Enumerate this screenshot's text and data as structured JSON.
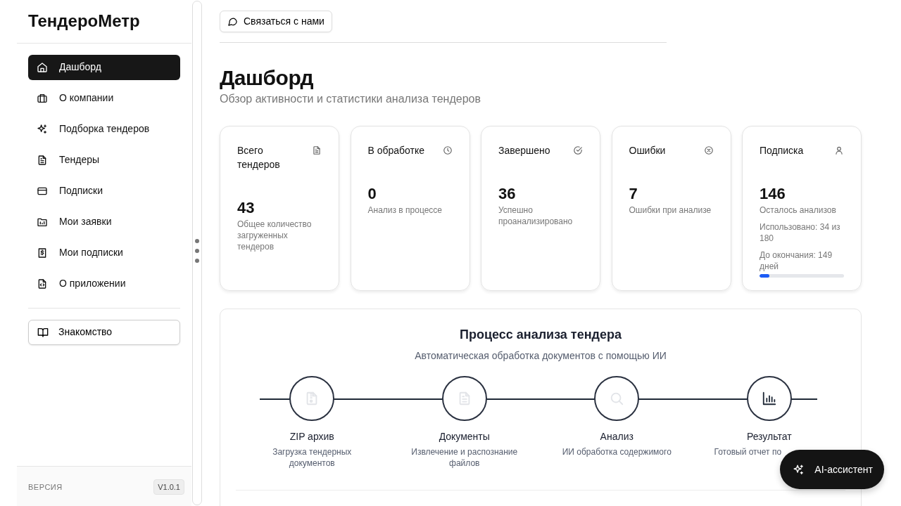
{
  "sidebar": {
    "logo": "ТендероМетр",
    "items": [
      {
        "label": "Дашборд",
        "selected": true
      },
      {
        "label": "О компании",
        "selected": false
      },
      {
        "label": "Подборка тендеров",
        "selected": false
      },
      {
        "label": "Тендеры",
        "selected": false
      },
      {
        "label": "Подписки",
        "selected": false
      },
      {
        "label": "Мои заявки",
        "selected": false
      },
      {
        "label": "Мои подписки",
        "selected": false
      },
      {
        "label": "О приложении",
        "selected": false
      }
    ],
    "tour_button": "Знакомство",
    "version_label": "ВЕРСИЯ",
    "version": "V1.0.1"
  },
  "contact_button": "Связаться с нами",
  "page": {
    "title": "Дашборд",
    "subtitle": "Обзор активности и статистики анализа тендеров"
  },
  "stats": [
    {
      "title": "Всего тендеров",
      "value": "43",
      "caption": "Общее количество загруженных тендеров"
    },
    {
      "title": "В обработке",
      "value": "0",
      "caption": "Анализ в процессе"
    },
    {
      "title": "Завершено",
      "value": "36",
      "caption": "Успешно проанализировано"
    },
    {
      "title": "Ошибки",
      "value": "7",
      "caption": "Ошибки при анализе"
    },
    {
      "title": "Подписка",
      "value": "146",
      "caption": "Осталось анализов",
      "details": [
        "Использовано: 34 из 180",
        "До окончания: 149 дней"
      ],
      "level": 0.12
    }
  ],
  "process": {
    "title": "Процесс анализа тендера",
    "subtitle": "Автоматическая обработка документов с помощью ИИ",
    "steps": [
      {
        "title": "ZIP архив",
        "caption": "Загрузка тендерных документов",
        "active": false
      },
      {
        "title": "Документы",
        "caption": "Извлечение и распознание файлов",
        "active": false
      },
      {
        "title": "Анализ",
        "caption": "ИИ обработка содержимого",
        "active": false
      },
      {
        "title": "Результат",
        "caption": "Готовый отчет по",
        "active": true
      }
    ]
  },
  "assistant_button": "AI-ассистент"
}
